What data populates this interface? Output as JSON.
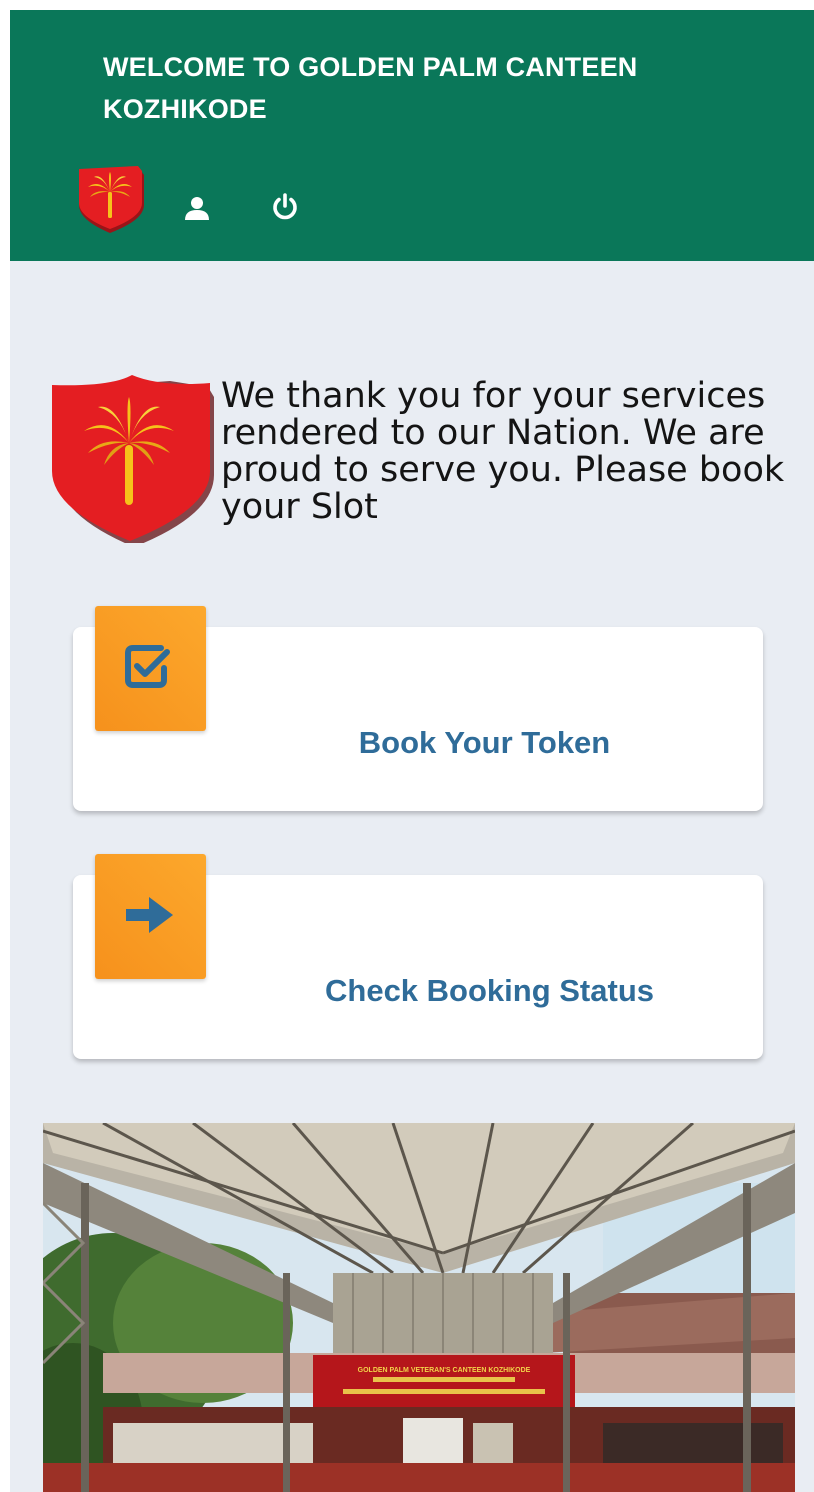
{
  "header": {
    "title": "WELCOME TO GOLDEN PALM CANTEEN KOZHIKODE",
    "icons": [
      "golden-palm-logo",
      "user-icon",
      "power-icon"
    ]
  },
  "welcome": {
    "message": "We thank you for your services rendered to our Nation. We are proud to serve you. Please book your Slot"
  },
  "actions": [
    {
      "label": "Book Your Token",
      "icon": "check-square-icon"
    },
    {
      "label": "Check Booking Status",
      "icon": "arrow-right-icon"
    }
  ],
  "photo": {
    "sign_text": "GOLDEN PALM VETERAN'S CANTEEN KOZHIKODE"
  },
  "colors": {
    "header_bg": "#0a7759",
    "page_bg": "#e9edf3",
    "card_bg": "#ffffff",
    "badge_orange": "#f8991f",
    "action_text": "#2f6c99",
    "logo_red": "#e41e22",
    "palm_gold": "#f6c21a"
  }
}
